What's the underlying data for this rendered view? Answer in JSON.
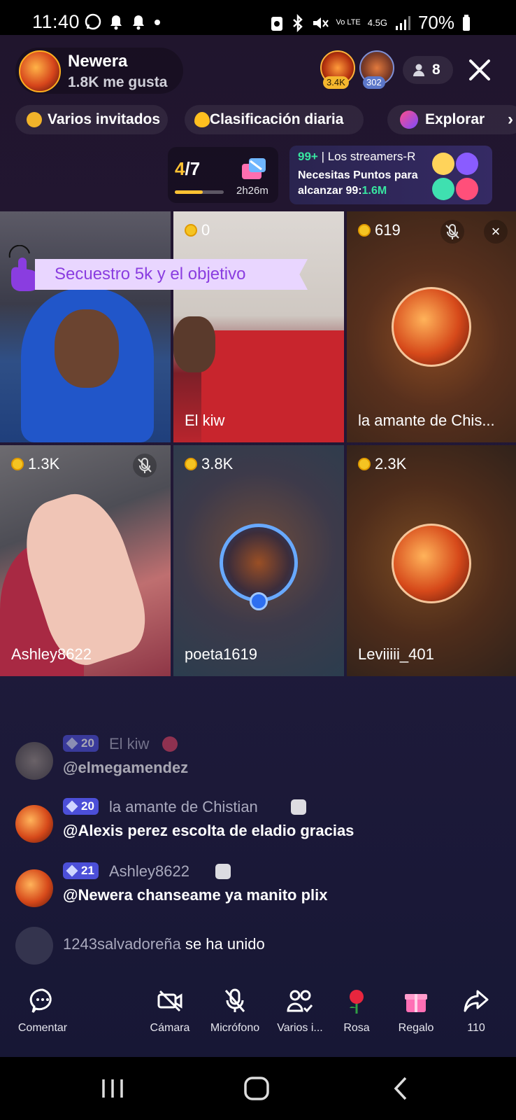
{
  "status_bar": {
    "time": "11:40",
    "battery": "70%",
    "network": "4.5G",
    "volte": "Vo LTE"
  },
  "host": {
    "name": "Newera",
    "likes": "1.8K me gusta"
  },
  "viewers": {
    "badge1": "3.4K",
    "badge2": "302",
    "count": "8"
  },
  "chips": {
    "multi_guest": "Varios invitados",
    "daily_ranking": "Clasificación diaria",
    "explore": "Explorar"
  },
  "progress": {
    "current": "4",
    "total": "/7",
    "fill_fraction": 0.57,
    "time": "2h26m"
  },
  "event": {
    "rank": "99+",
    "title": "| Los streamers-R",
    "line2": "Necesitas Puntos para",
    "line3_prefix": "alcanzar 99:",
    "line3_value": "1.6M"
  },
  "goal_banner": "Secuestro 5k y el objetivo",
  "tiles": [
    {
      "coins": "",
      "name": ""
    },
    {
      "coins": "0",
      "name": "El kiw"
    },
    {
      "coins": "619",
      "name": "la amante de Chis..."
    },
    {
      "coins": "1.3K",
      "name": "Ashley8622"
    },
    {
      "coins": "3.8K",
      "name": "poeta1619"
    },
    {
      "coins": "2.3K",
      "name": "Leviiiii_401"
    }
  ],
  "comments": [
    {
      "level": "20",
      "user": "El kiw",
      "text": "@elmegamendez"
    },
    {
      "level": "20",
      "user": "la amante de Chistian",
      "text": "@Alexis perez escolta de eladio gracias"
    },
    {
      "level": "21",
      "user": "Ashley8622",
      "text": "@Newera chanseame ya manito plix"
    }
  ],
  "join_notice": {
    "user": "1243salvadoreña",
    "action": "se ha unido"
  },
  "bottom_bar": {
    "comment": "Comentar",
    "camera": "Cámara",
    "mic": "Micrófono",
    "guests": "Varios i...",
    "rose": "Rosa",
    "gift": "Regalo",
    "share": "110"
  },
  "colors": {
    "accent_gold": "#ffc233",
    "accent_green": "#38e6a1",
    "badge_blue": "#4c4fd8",
    "banner_bg": "#e9d6ff",
    "banner_text": "#8a3de0"
  }
}
